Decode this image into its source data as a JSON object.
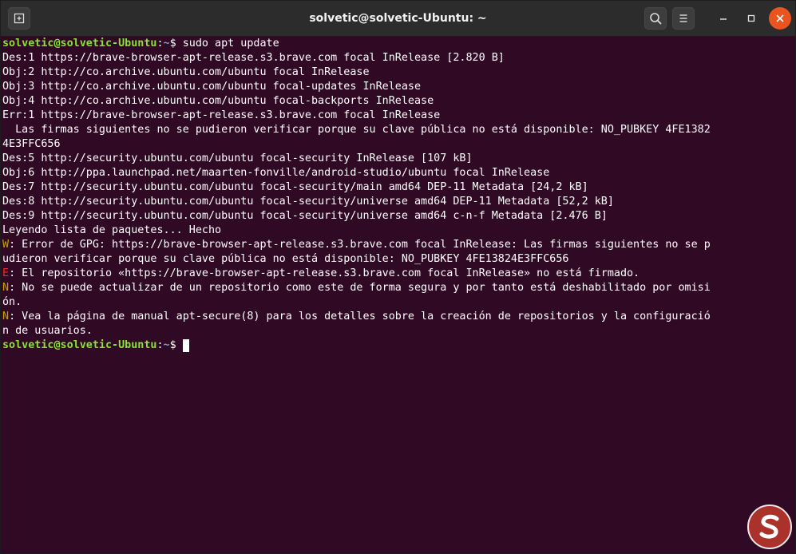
{
  "window": {
    "title": "solvetic@solvetic-Ubuntu: ~",
    "accent_close_color": "#e95420",
    "background_color": "#300a24"
  },
  "titlebar_icons": {
    "new_tab": "new-tab-icon",
    "search": "search-icon",
    "menu": "hamburger-menu-icon",
    "minimize": "minimize-icon",
    "maximize": "maximize-icon",
    "close": "close-icon"
  },
  "prompt": {
    "user_host": "solvetic@solvetic-Ubuntu",
    "colon": ":",
    "path": "~",
    "symbol": "$ "
  },
  "command": "sudo apt update",
  "output": {
    "line1": "Des:1 https://brave-browser-apt-release.s3.brave.com focal InRelease [2.820 B]",
    "line2": "Obj:2 http://co.archive.ubuntu.com/ubuntu focal InRelease",
    "line3": "Obj:3 http://co.archive.ubuntu.com/ubuntu focal-updates InRelease",
    "line4": "Obj:4 http://co.archive.ubuntu.com/ubuntu focal-backports InRelease",
    "line5": "Err:1 https://brave-browser-apt-release.s3.brave.com focal InRelease",
    "line6": "  Las firmas siguientes no se pudieron verificar porque su clave pública no está disponible: NO_PUBKEY 4FE1382",
    "line7": "4E3FFC656",
    "line8": "Des:5 http://security.ubuntu.com/ubuntu focal-security InRelease [107 kB]",
    "line9": "Obj:6 http://ppa.launchpad.net/maarten-fonville/android-studio/ubuntu focal InRelease",
    "line10": "Des:7 http://security.ubuntu.com/ubuntu focal-security/main amd64 DEP-11 Metadata [24,2 kB]",
    "line11": "Des:8 http://security.ubuntu.com/ubuntu focal-security/universe amd64 DEP-11 Metadata [52,2 kB]",
    "line12": "Des:9 http://security.ubuntu.com/ubuntu focal-security/universe amd64 c-n-f Metadata [2.476 B]",
    "line13": "Leyendo lista de paquetes... Hecho",
    "warn_flag": "W",
    "warn_text_a": ": Error de GPG: https://brave-browser-apt-release.s3.brave.com focal InRelease: Las firmas siguientes no se p",
    "warn_text_b": "udieron verificar porque su clave pública no está disponible: NO_PUBKEY 4FE13824E3FFC656",
    "err_flag": "E",
    "err_text": ": El repositorio «https://brave-browser-apt-release.s3.brave.com focal InRelease» no está firmado.",
    "note1_flag": "N",
    "note1_text_a": ": No se puede actualizar de un repositorio como este de forma segura y por tanto está deshabilitado por omisi",
    "note1_text_b": "ón.",
    "note2_flag": "N",
    "note2_text_a": ": Vea la página de manual apt-secure(8) para los detalles sobre la creación de repositorios y la configuració",
    "note2_text_b": "n de usuarios."
  },
  "watermark": {
    "icon": "solvetic-logo-icon",
    "color": "#c0392b"
  }
}
